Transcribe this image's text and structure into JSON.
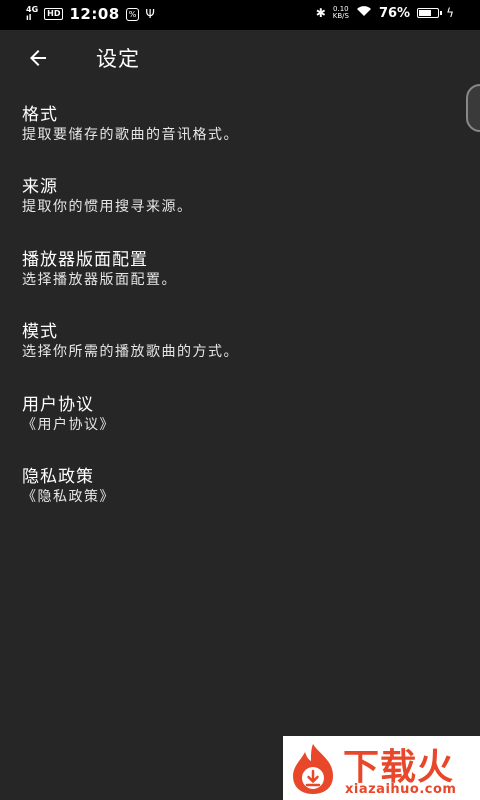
{
  "status_bar": {
    "network": "4G",
    "signal_sub": "ıl",
    "hd_badge": "HD",
    "time": "12:08",
    "notif_badge": "%",
    "usb_icon": "Ψ",
    "bluetooth_icon": "✱",
    "speed_value": "0.10",
    "speed_unit": "KB/S",
    "wifi_icon": "◠",
    "battery_percent": "76%",
    "battery_level": 0.76,
    "charging_icon": "ϟ"
  },
  "app_bar": {
    "title": "设定",
    "back_icon": "arrow-back-icon"
  },
  "settings": [
    {
      "title": "格式",
      "description": "提取要储存的歌曲的音讯格式。"
    },
    {
      "title": "来源",
      "description": "提取你的惯用搜寻来源。"
    },
    {
      "title": "播放器版面配置",
      "description": "选择播放器版面配置。"
    },
    {
      "title": "模式",
      "description": "选择你所需的播放歌曲的方式。"
    },
    {
      "title": "用户协议",
      "description": "《用户协议》"
    },
    {
      "title": "隐私政策",
      "description": "《隐私政策》"
    }
  ],
  "watermark": {
    "brand": "下载火",
    "url": "xiazaihuo.com",
    "color": "#e8472a"
  },
  "colors": {
    "background": "#262626",
    "status_bar": "#000000",
    "text_primary": "#ffffff"
  }
}
